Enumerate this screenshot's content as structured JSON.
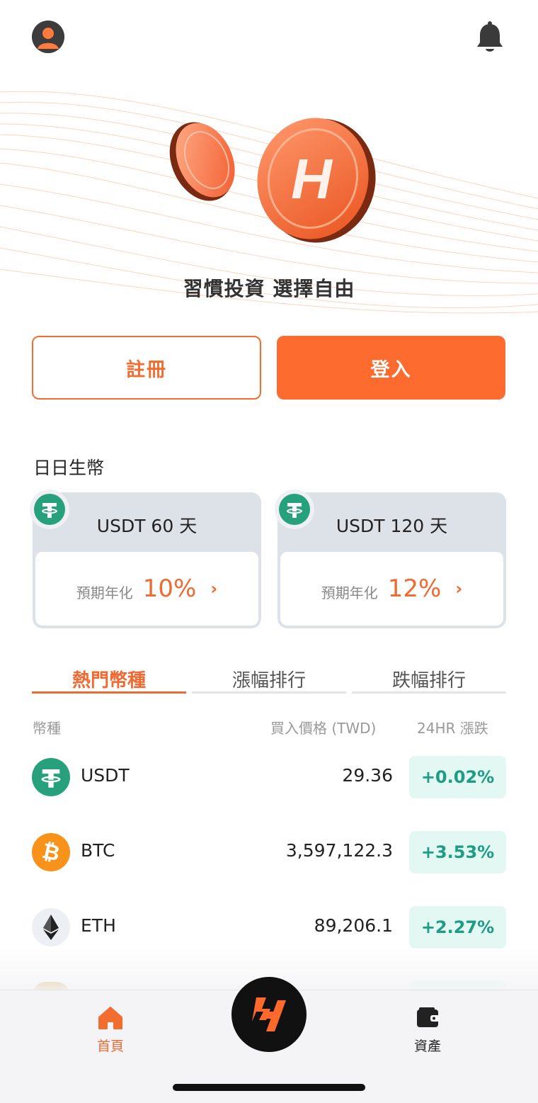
{
  "header": {
    "avatar_icon": "user-avatar-icon",
    "bell_icon": "bell-icon"
  },
  "hero": {
    "slogan": "習慣投資 選擇自由",
    "coin_letter": "H"
  },
  "auth": {
    "register_label": "註冊",
    "login_label": "登入"
  },
  "savings": {
    "title": "日日生幣",
    "products": [
      {
        "title": "USDT  60 天",
        "apr_label": "預期年化",
        "apr_value": "10%",
        "chevron": "›"
      },
      {
        "title": "USDT  120 天",
        "apr_label": "預期年化",
        "apr_value": "12%",
        "chevron": "›"
      }
    ]
  },
  "market": {
    "tabs": [
      {
        "label": "熱門幣種",
        "active": true
      },
      {
        "label": "漲幅排行",
        "active": false
      },
      {
        "label": "跌幅排行",
        "active": false
      }
    ],
    "columns": {
      "coin": "幣種",
      "price": "買入價格 (TWD)",
      "change": "24HR 漲跌"
    },
    "rows": [
      {
        "symbol": "USDT",
        "price": "29.36",
        "change": "+0.02%",
        "icon": "tether-icon",
        "color": "#26a17b"
      },
      {
        "symbol": "BTC",
        "price": "3,597,122.3",
        "change": "+3.53%",
        "icon": "bitcoin-icon",
        "color": "#f7931a"
      },
      {
        "symbol": "ETH",
        "price": "89,206.1",
        "change": "+2.27%",
        "icon": "ethereum-icon",
        "color": "#eceff3"
      }
    ]
  },
  "bottom_nav": {
    "home_label": "首頁",
    "assets_label": "資產",
    "home_icon": "home-icon",
    "assets_icon": "wallet-icon",
    "center_icon": "brand-logo-icon"
  },
  "colors": {
    "accent": "#fd6b2f",
    "positive": "#1e9c84",
    "positive_bg": "#e3f7f3"
  }
}
